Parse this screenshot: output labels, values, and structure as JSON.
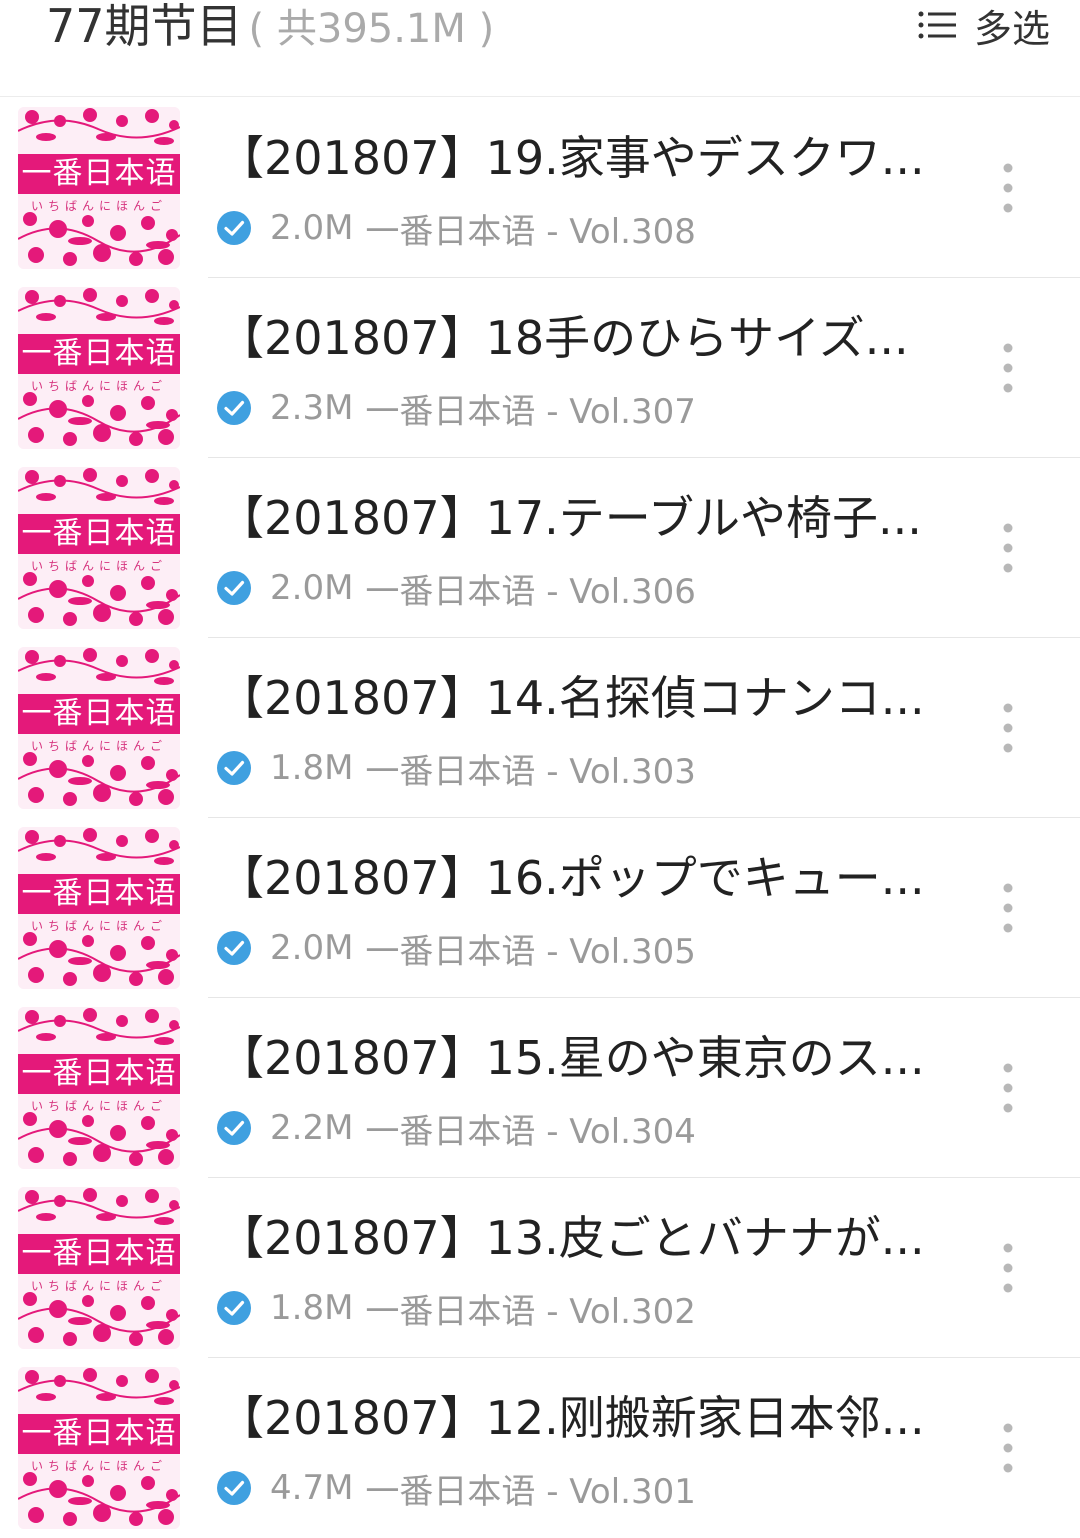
{
  "header": {
    "title": "77期节目",
    "total": "( 共395.1M )",
    "multi_select_label": "多选"
  },
  "colors": {
    "accent_pink": "#e4197a",
    "check_blue": "#3fa0e0",
    "meta_gray": "#9a9a9a"
  },
  "icons": {
    "multi_select": "list-icon",
    "downloaded": "check-circle-icon",
    "more": "more-vertical-icon"
  },
  "episodes": [
    {
      "title": "【201807】19.家事やデスクワ...",
      "size": "2.0M",
      "meta": "一番日本语 - Vol.308",
      "cover_label": "一番日本语",
      "cover_sub": "いちばんにほんご"
    },
    {
      "title": "【201807】18手のひらサイズ...",
      "size": "2.3M",
      "meta": "一番日本语 - Vol.307",
      "cover_label": "一番日本语",
      "cover_sub": "いちばんにほんご"
    },
    {
      "title": "【201807】17.テーブルや椅子...",
      "size": "2.0M",
      "meta": "一番日本语 - Vol.306",
      "cover_label": "一番日本语",
      "cover_sub": "いちばんにほんご"
    },
    {
      "title": "【201807】14.名探偵コナンコ...",
      "size": "1.8M",
      "meta": "一番日本语 - Vol.303",
      "cover_label": "一番日本语",
      "cover_sub": "いちばんにほんご"
    },
    {
      "title": "【201807】16.ポップでキュー...",
      "size": "2.0M",
      "meta": "一番日本语 - Vol.305",
      "cover_label": "一番日本语",
      "cover_sub": "いちばんにほんご"
    },
    {
      "title": "【201807】15.星のや東京のス...",
      "size": "2.2M",
      "meta": "一番日本语 - Vol.304",
      "cover_label": "一番日本语",
      "cover_sub": "いちばんにほんご"
    },
    {
      "title": "【201807】13.皮ごとバナナが...",
      "size": "1.8M",
      "meta": "一番日本语 - Vol.302",
      "cover_label": "一番日本语",
      "cover_sub": "いちばんにほんご"
    },
    {
      "title": "【201807】12.刚搬新家日本邻...",
      "size": "4.7M",
      "meta": "一番日本语 - Vol.301",
      "cover_label": "一番日本语",
      "cover_sub": "いちばんにほんご"
    }
  ]
}
